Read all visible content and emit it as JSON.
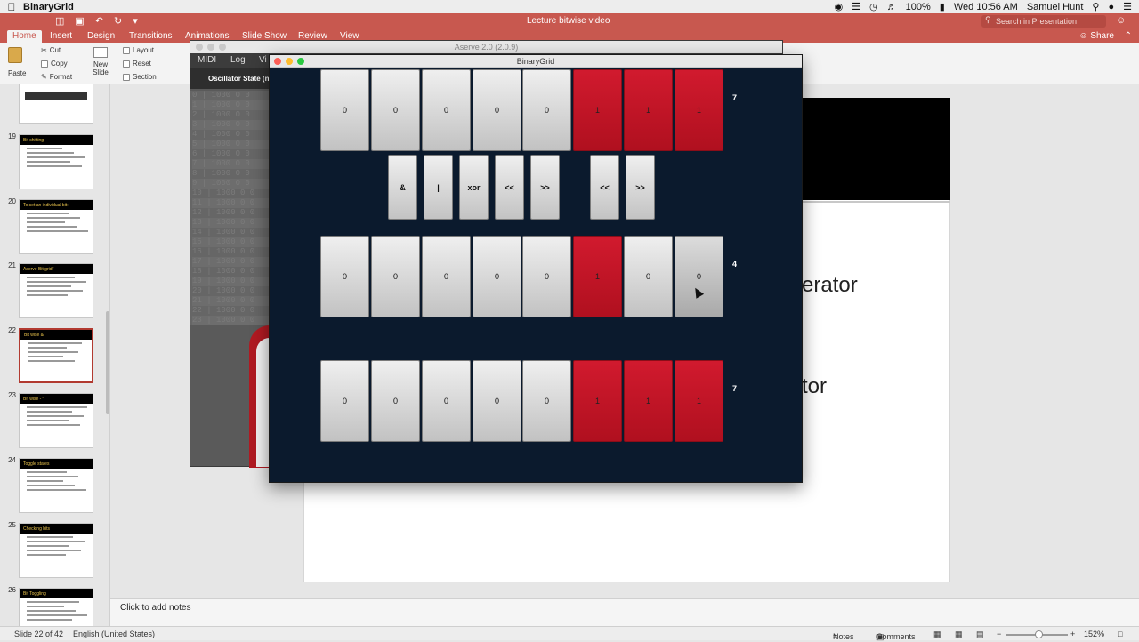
{
  "menubar": {
    "app_name": "BinaryGrid",
    "clock": "Wed 10:56 AM",
    "user": "Samuel Hunt",
    "battery": "100%"
  },
  "ppt": {
    "doc_title": "Lecture bitwise video",
    "search_placeholder": "Search in Presentation",
    "tabs": [
      "Home",
      "Insert",
      "Design",
      "Transitions",
      "Animations",
      "Slide Show",
      "Review",
      "View"
    ],
    "share_label": "Share",
    "ribbon": {
      "paste": "Paste",
      "cut": "Cut",
      "copy": "Copy",
      "format": "Format",
      "new_slide": "New Slide",
      "layout": "Layout",
      "reset": "Reset",
      "section": "Section"
    },
    "slides": [
      {
        "num": "19",
        "title": "Bit shifting"
      },
      {
        "num": "20",
        "title": "To set an individual bit:"
      },
      {
        "num": "21",
        "title": "Aserve Bit grid*"
      },
      {
        "num": "22",
        "title": "Bit wise &"
      },
      {
        "num": "23",
        "title": "Bit wise - ^"
      },
      {
        "num": "24",
        "title": "Toggle states"
      },
      {
        "num": "25",
        "title": "Checking bits"
      },
      {
        "num": "26",
        "title": "Bit Toggling"
      }
    ],
    "selected_slide": "22",
    "slide_text_1": "erator",
    "slide_text_2": "tor",
    "notes_placeholder": "Click to add notes",
    "status": {
      "slide_of": "Slide 22 of 42",
      "language": "English (United States)",
      "notes": "Notes",
      "comments": "Comments",
      "zoom": "152%"
    }
  },
  "aserve": {
    "title": "Aserve 2.0 (2.0.9)",
    "tabs": [
      "MIDI",
      "Log",
      "Vi"
    ],
    "osc_header": "Oscillator State (n",
    "osc_rows": [
      "0 | 1000 0 0",
      "1 | 1000 0 0",
      "2 | 1000 0 0",
      "3 | 1000 0 0",
      "4 | 1000 0 0",
      "5 | 1000 0 0",
      "6 | 1000 0 0",
      "7 | 1000 0 0",
      "8 | 1000 0 0",
      "9 | 1000 0 0",
      "10 | 1000 0 0",
      "11 | 1000 0 0",
      "12 | 1000 0 0",
      "13 | 1000 0 0",
      "14 | 1000 0 0",
      "15 | 1000 0 0",
      "16 | 1000 0 0",
      "17 | 1000 0 0",
      "18 | 1000 0 0",
      "19 | 1000 0 0",
      "20 | 1000 0 0",
      "21 | 1000 0 0",
      "22 | 1000 0 0",
      "23 | 1000 0 0"
    ]
  },
  "binarygrid": {
    "title": "BinaryGrid",
    "row_a": {
      "bits": [
        "0",
        "0",
        "0",
        "0",
        "0",
        "1",
        "1",
        "1"
      ],
      "value": "7"
    },
    "row_b": {
      "bits": [
        "0",
        "0",
        "0",
        "0",
        "0",
        "1",
        "0",
        "0"
      ],
      "value": "4"
    },
    "row_result": {
      "bits": [
        "0",
        "0",
        "0",
        "0",
        "0",
        "1",
        "1",
        "1"
      ],
      "value": "7"
    },
    "operators": [
      "&",
      "|",
      "xor",
      "<<",
      ">>"
    ],
    "shift_ops": [
      "<<",
      ">>"
    ],
    "colors": {
      "on": "#c8142a",
      "off": "#d9d9d9",
      "background": "#0b1a2d"
    }
  }
}
